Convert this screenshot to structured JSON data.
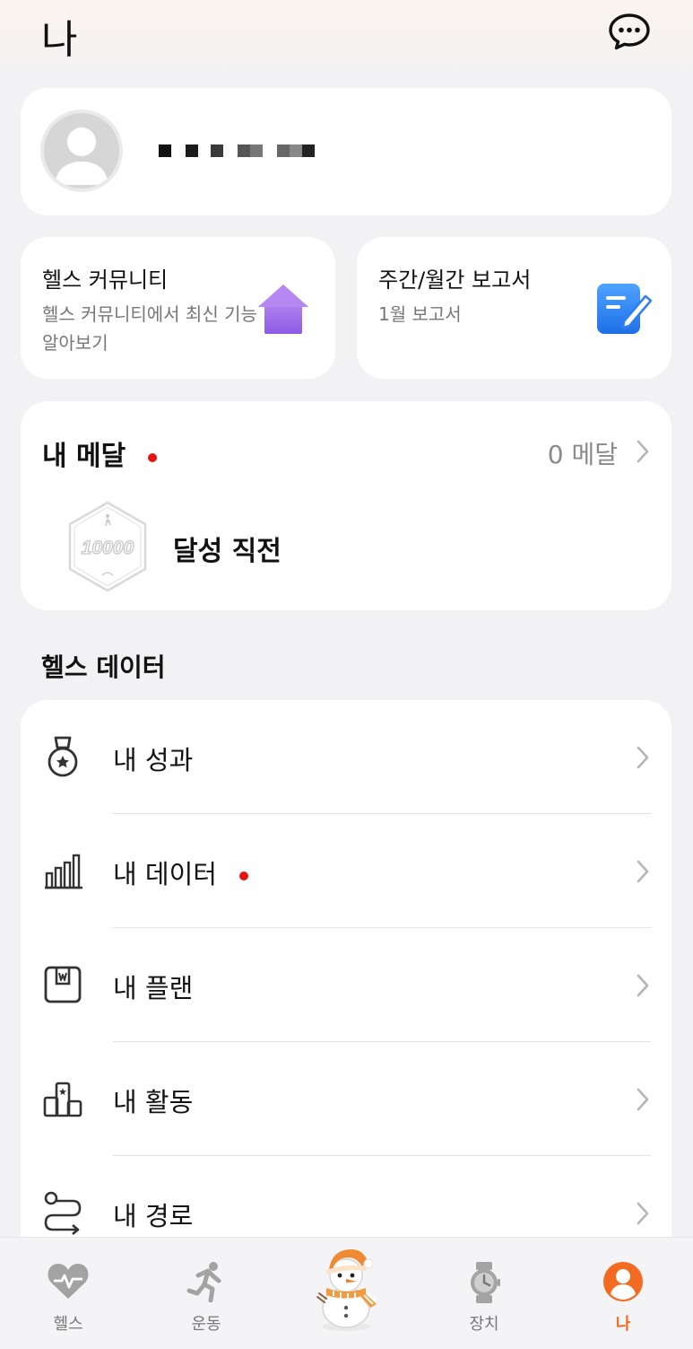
{
  "header": {
    "title": "나",
    "chat_icon": "chat-bubble-icon"
  },
  "profile": {
    "avatar_icon": "default-avatar-icon",
    "name_placeholder": "blurred-username"
  },
  "cards": {
    "community": {
      "title": "헬스 커뮤니티",
      "subtitle": "헬스 커뮤니티에서 최신 기능 알아보기",
      "icon": "house-icon"
    },
    "report": {
      "title": "주간/월간 보고서",
      "subtitle": "1월 보고서",
      "icon": "report-edit-icon"
    }
  },
  "medals": {
    "title": "내 메달",
    "count": "0 메달",
    "badge_text": "10000",
    "status": "달성 직전"
  },
  "health_data": {
    "section_title": "헬스 데이터",
    "items": [
      {
        "label": "내 성과",
        "icon": "medal-icon",
        "dot": false
      },
      {
        "label": "내 데이터",
        "icon": "bar-chart-icon",
        "dot": true
      },
      {
        "label": "내 플랜",
        "icon": "plan-icon",
        "dot": false
      },
      {
        "label": "내 활동",
        "icon": "podium-icon",
        "dot": false
      },
      {
        "label": "내 경로",
        "icon": "route-icon",
        "dot": false
      }
    ]
  },
  "nav": {
    "items": [
      {
        "label": "헬스",
        "icon": "heart-icon"
      },
      {
        "label": "운동",
        "icon": "running-icon"
      },
      {
        "label": "",
        "icon": "snowman-icon"
      },
      {
        "label": "장치",
        "icon": "watch-icon"
      },
      {
        "label": "나",
        "icon": "profile-icon",
        "active": true
      }
    ]
  },
  "colors": {
    "accent": "#f26b21",
    "dot": "#e81313",
    "background": "#f2f2f4"
  }
}
